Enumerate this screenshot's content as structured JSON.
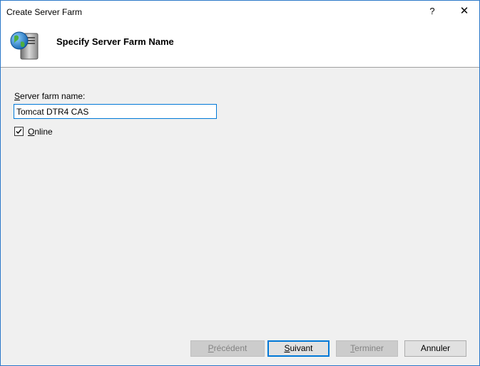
{
  "window": {
    "title": "Create Server Farm",
    "help_label": "?",
    "close_label": "✕"
  },
  "header": {
    "title": "Specify Server Farm Name",
    "icon": "server-globe-icon"
  },
  "form": {
    "name_label_first": "S",
    "name_label_rest": "erver farm name:",
    "name_value": "Tomcat DTR4 CAS",
    "online_checked": true,
    "online_label_first": "O",
    "online_label_rest": "nline"
  },
  "buttons": {
    "previous": {
      "first": "P",
      "rest": "récédent",
      "enabled": false
    },
    "next": {
      "first": "S",
      "rest": "uivant",
      "enabled": true
    },
    "finish": {
      "first": "T",
      "rest": "erminer",
      "enabled": false
    },
    "cancel": {
      "label": "Annuler",
      "enabled": true
    }
  },
  "colors": {
    "accent": "#0078d7",
    "dialog_bg": "#f0f0f0"
  }
}
